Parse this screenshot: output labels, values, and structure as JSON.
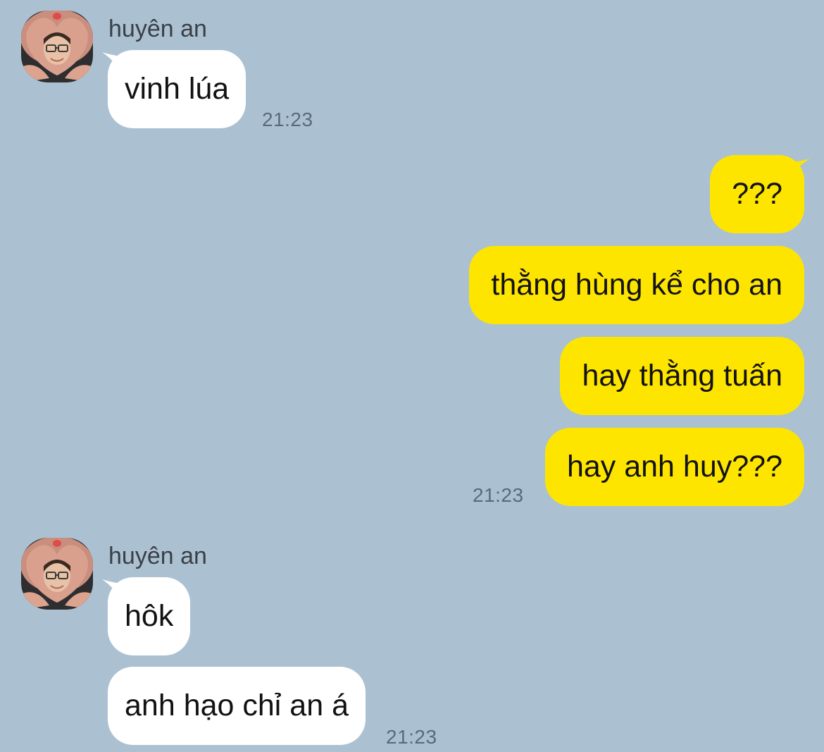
{
  "colors": {
    "background": "#abc1d2",
    "incoming_bubble": "#ffffff",
    "outgoing_bubble": "#fee500"
  },
  "avatar_icon": "user-avatar-heart-hands-photo",
  "groups": [
    {
      "sender": "huyên an",
      "messages": [
        "vinh lúa"
      ],
      "time": "21:23"
    },
    {
      "sender": "",
      "messages": [
        "???",
        "thằng hùng kể cho an",
        "hay thằng tuấn",
        "hay anh huy???"
      ],
      "time": "21:23"
    },
    {
      "sender": "huyên an",
      "messages": [
        "hôk",
        "anh hạo chỉ an á"
      ],
      "time": "21:23"
    }
  ]
}
